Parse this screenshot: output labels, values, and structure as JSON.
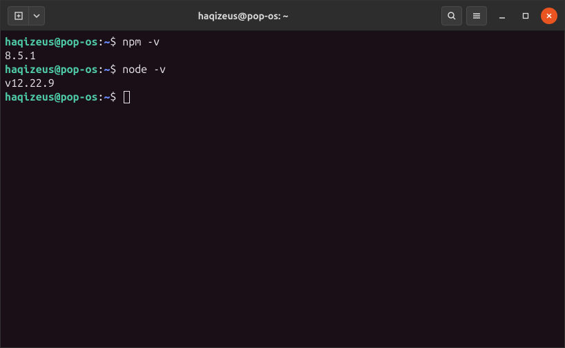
{
  "titlebar": {
    "title": "haqizeus@pop-os: ~"
  },
  "prompt": {
    "user_host": "haqizeus@pop-os",
    "separator": ":",
    "path": "~",
    "symbol": "$"
  },
  "session": [
    {
      "command": "npm -v",
      "output": "8.5.1"
    },
    {
      "command": "node -v",
      "output": "v12.22.9"
    }
  ]
}
